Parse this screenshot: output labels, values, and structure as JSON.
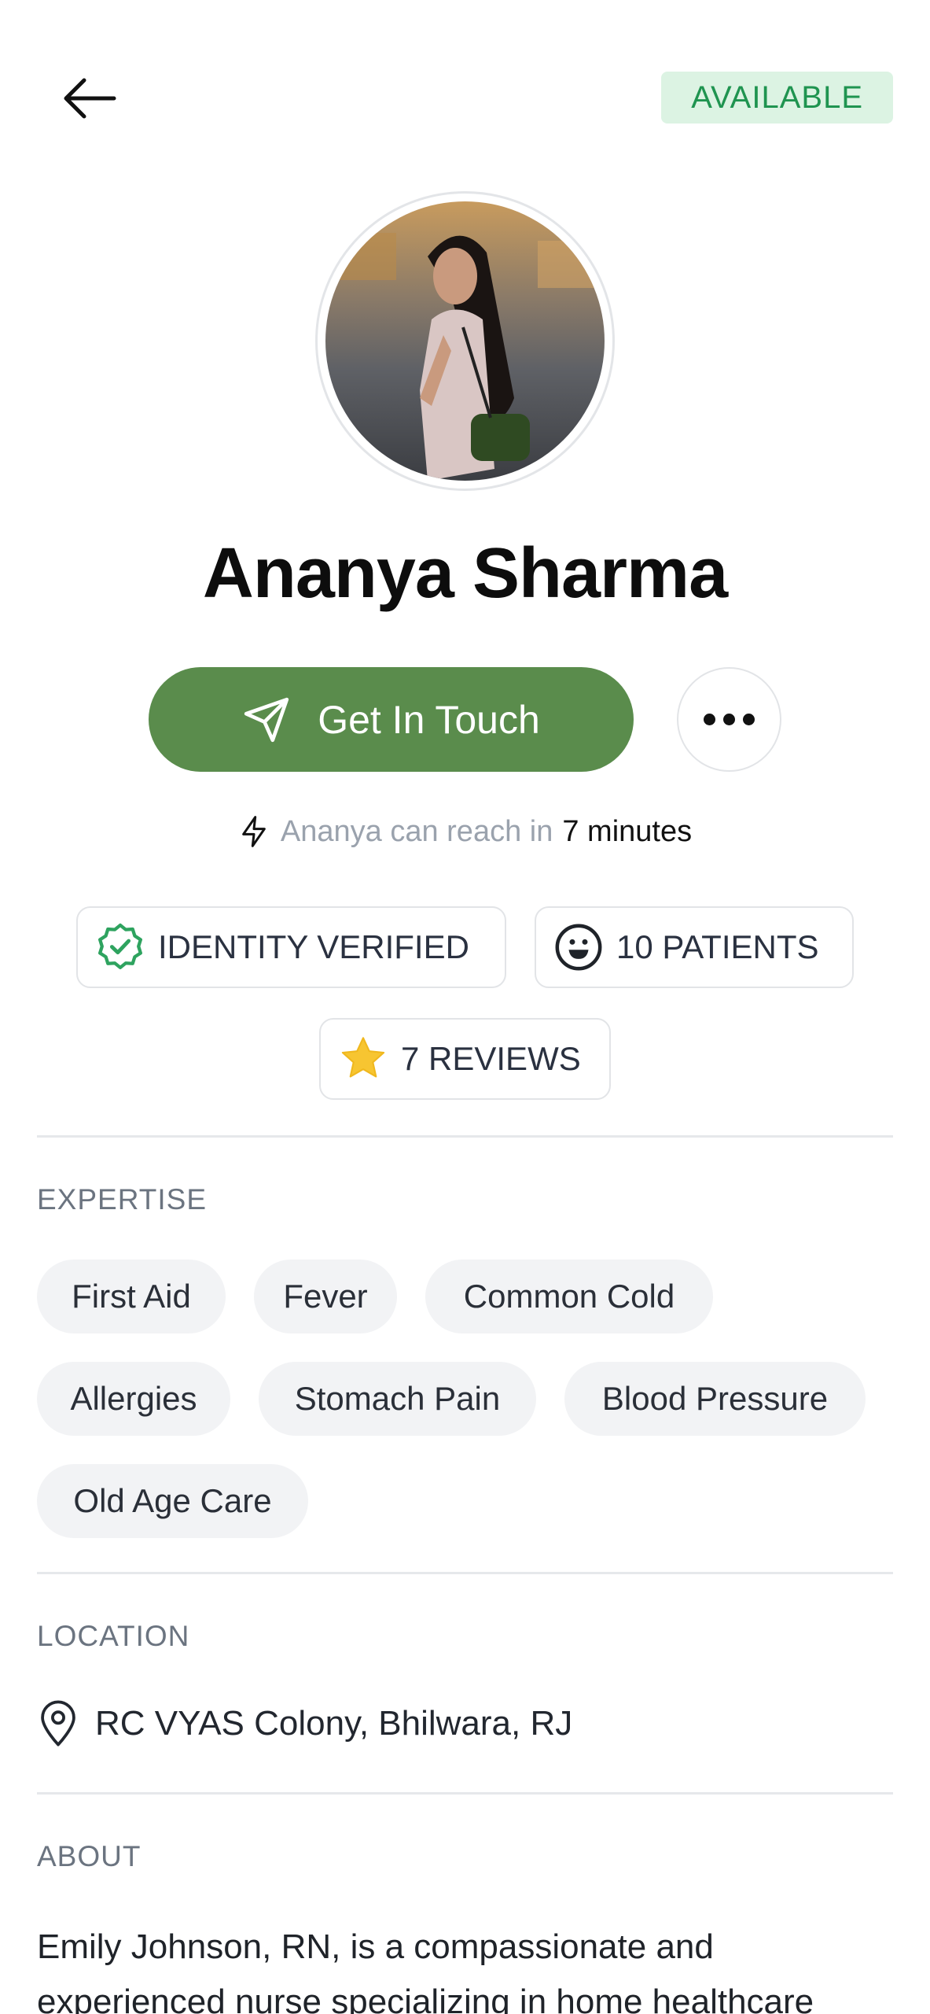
{
  "header": {
    "back_icon": "arrow-left-icon",
    "status": "AVAILABLE",
    "status_color": "#1f9450"
  },
  "profile": {
    "name": "Ananya Sharma",
    "avatar_alt": "Profile photo",
    "cta_label": "Get In Touch",
    "cta_color": "#5a8c4c",
    "cta_icon": "send-icon",
    "more_icon": "more-dots-icon"
  },
  "reach": {
    "prefix": "Ananya can reach in",
    "time": "7 minutes"
  },
  "stats": [
    {
      "label": "IDENTITY VERIFIED",
      "icon": "verified-badge-icon"
    },
    {
      "label": "10 PATIENTS",
      "icon": "smiley-icon"
    },
    {
      "label": "7 REVIEWS",
      "icon": "star-icon"
    }
  ],
  "expertise": {
    "title": "EXPERTISE",
    "tags": [
      "First Aid",
      "Fever",
      "Common Cold",
      "Allergies",
      "Stomach Pain",
      "Blood Pressure",
      "Old Age Care"
    ]
  },
  "location": {
    "title": "LOCATION",
    "icon": "map-pin-icon",
    "address": "RC VYAS Colony, Bhilwara, RJ"
  },
  "about": {
    "title": "ABOUT",
    "text": "Emily Johnson, RN, is a compassionate and experienced nurse specializing in home healthcare"
  }
}
